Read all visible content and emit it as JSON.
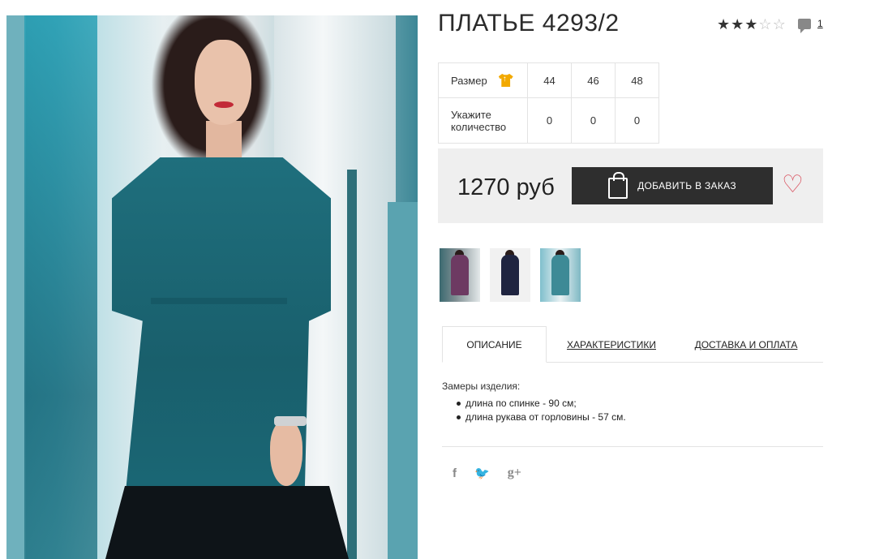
{
  "product": {
    "title": "ПЛАТЬЕ 4293/2",
    "rating": {
      "value": 3,
      "max": 5,
      "icon": "star-icon"
    },
    "comments_count": "1"
  },
  "sizes_table": {
    "size_label": "Размер",
    "qty_label": "Укажите количество",
    "sizes": [
      "44",
      "46",
      "48"
    ],
    "quantities": [
      "0",
      "0",
      "0"
    ],
    "size_chart_icon": "tshirt-icon",
    "accent_color": "#f2a900"
  },
  "purchase": {
    "price": "1270 руб",
    "add_button_label": "ДОБАВИТЬ В ЗАКАЗ",
    "button_color": "#2e2e2e",
    "favorite_icon": "heart-icon",
    "favorite_color": "#d9515f"
  },
  "thumbnails": [
    "purple-dress",
    "navy-dress",
    "teal-dress"
  ],
  "tabs": [
    {
      "label": "ОПИСАНИЕ",
      "active": true
    },
    {
      "label": "ХАРАКТЕРИСТИКИ",
      "active": false
    },
    {
      "label": "ДОСТАВКА И ОПЛАТА",
      "active": false
    }
  ],
  "description": {
    "heading": "Замеры изделия:",
    "items": [
      "длина по спинке - 90 см;",
      "длина рукава от горловины - 57 см."
    ]
  },
  "social": {
    "facebook": "f",
    "twitter": "🐦",
    "google_plus": "g+"
  }
}
